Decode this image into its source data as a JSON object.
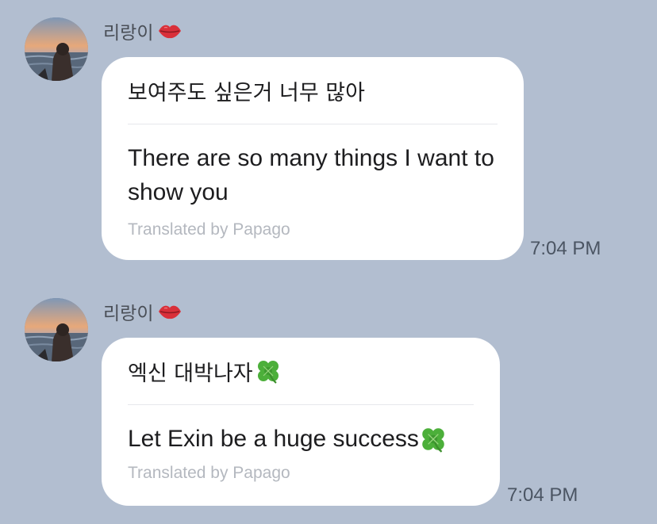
{
  "messages": [
    {
      "sender": "리랑이",
      "original": "보여주도 싶은거 너무 많아",
      "translation": "There are so many things I want to show you",
      "credit": "Translated by Papago",
      "time": "7:04 PM"
    },
    {
      "sender": "리랑이",
      "original": "엑신 대박나자",
      "translation": "Let Exin be a huge success",
      "credit": "Translated by Papago",
      "time": "7:04 PM"
    }
  ],
  "icons": {
    "sender_badge": "lips-icon",
    "emoji": "four-leaf-clover-icon"
  },
  "colors": {
    "background": "#b2bed0",
    "bubble": "#ffffff",
    "credit_text": "#b4b8bf",
    "lips": "#d9303a",
    "clover": "#4caf3a"
  }
}
